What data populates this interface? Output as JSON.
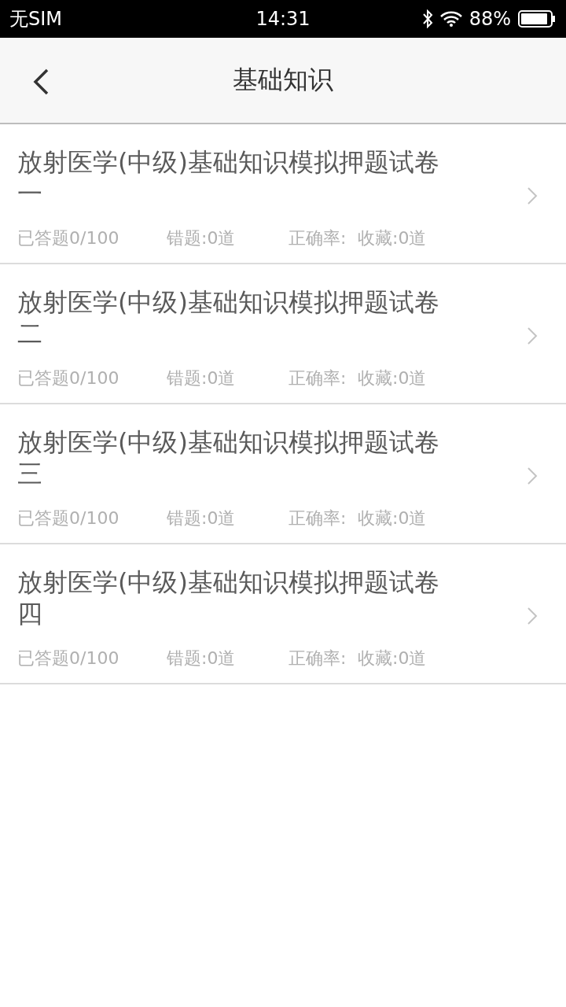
{
  "status_bar": {
    "carrier": "无SIM",
    "time": "14:31",
    "battery_percent": "88%"
  },
  "nav": {
    "title": "基础知识"
  },
  "papers": [
    {
      "title": "放射医学(中级)基础知识模拟押题试卷一",
      "answered": "已答题0/100",
      "wrong": "错题:0道",
      "accuracy": "正确率:",
      "favorites": "收藏:0道"
    },
    {
      "title": "放射医学(中级)基础知识模拟押题试卷二",
      "answered": "已答题0/100",
      "wrong": "错题:0道",
      "accuracy": "正确率:",
      "favorites": "收藏:0道"
    },
    {
      "title": "放射医学(中级)基础知识模拟押题试卷三",
      "answered": "已答题0/100",
      "wrong": "错题:0道",
      "accuracy": "正确率:",
      "favorites": "收藏:0道"
    },
    {
      "title": "放射医学(中级)基础知识模拟押题试卷四",
      "answered": "已答题0/100",
      "wrong": "错题:0道",
      "accuracy": "正确率:",
      "favorites": "收藏:0道"
    }
  ]
}
